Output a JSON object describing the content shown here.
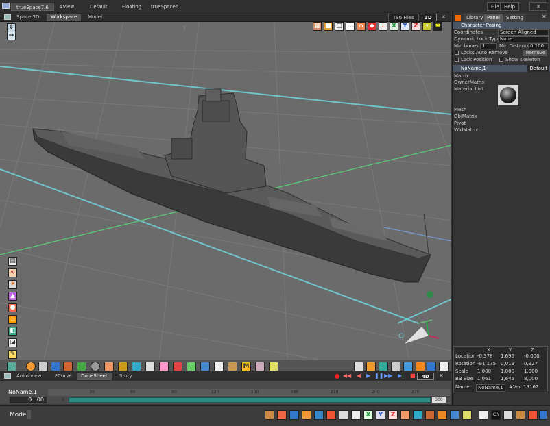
{
  "app": {
    "title": "trueSpace7.6",
    "top_tabs": [
      "4View",
      "Default",
      "Floating",
      "trueSpace6"
    ],
    "file_label": "File",
    "help_label": "Help"
  },
  "viewport": {
    "title": "Space 3D",
    "tabs": [
      "Workspace",
      "Model"
    ],
    "ts6_files_label": "TS6 Files",
    "mode_3d_label": "3D",
    "axis_x": "X",
    "axis_y": "Y",
    "axis_z": "Z"
  },
  "right_panel": {
    "tabs": [
      "Library",
      "Panel",
      "Setting"
    ],
    "character_posing": {
      "header": "Character Posing",
      "coordinates_label": "Coordinates",
      "coordinates_value": "Screen Aligned",
      "dynamic_lock_label": "Dynamic Lock Type",
      "dynamic_lock_value": "None",
      "min_bones_label": "Min bones",
      "min_bones_value": "1",
      "min_distance_label": "Min Distance",
      "min_distance_value": "0,100",
      "locks_auto_remove_label": "Locks Auto Remove",
      "remove_label": "Remove",
      "lock_position_label": "Lock Position",
      "show_skeleton_label": "Show skeleton"
    },
    "object_panel": {
      "name": "NoName,1",
      "preset": "Default",
      "items": [
        "Matrix",
        "OwnerMatrix",
        "Material List",
        "Mesh",
        "ObjMatrix",
        "Pivot",
        "WldMatrix"
      ]
    },
    "coords": {
      "headers": [
        "X",
        "Y",
        "Z"
      ],
      "location_label": "Location",
      "location": [
        "-0,378",
        "1,695",
        "-0,000"
      ],
      "rotation_label": "Rotation",
      "rotation": [
        "-91,175",
        "0,019",
        "0,927"
      ],
      "scale_label": "Scale",
      "scale": [
        "1,000",
        "1,000",
        "1,000"
      ],
      "bbsize_label": "BB Size",
      "bbsize": [
        "1,061",
        "1,645",
        "8,000"
      ],
      "name_label": "Name",
      "name_value": "NoName,1",
      "version": "#Ver. 19162"
    }
  },
  "anim": {
    "tabs": [
      "Anim view",
      "FCurve",
      "DopeSheet",
      "Story"
    ],
    "mode_label": "4D",
    "track_name": "NoName,1",
    "time_value": "0 . 00",
    "start_frame": "0",
    "end_frame": "300",
    "ruler_ticks": [
      "30",
      "60",
      "90",
      "120",
      "150",
      "180",
      "210",
      "240",
      "270"
    ]
  },
  "status": {
    "mode": "Model"
  },
  "colors": {
    "grid_cyan": "#6fc6cc",
    "axis_green": "#5ad07a",
    "axis_blue": "#7aa0e6",
    "viewport_bg": "#6b6b6b",
    "panel_header": "#4a5566"
  }
}
